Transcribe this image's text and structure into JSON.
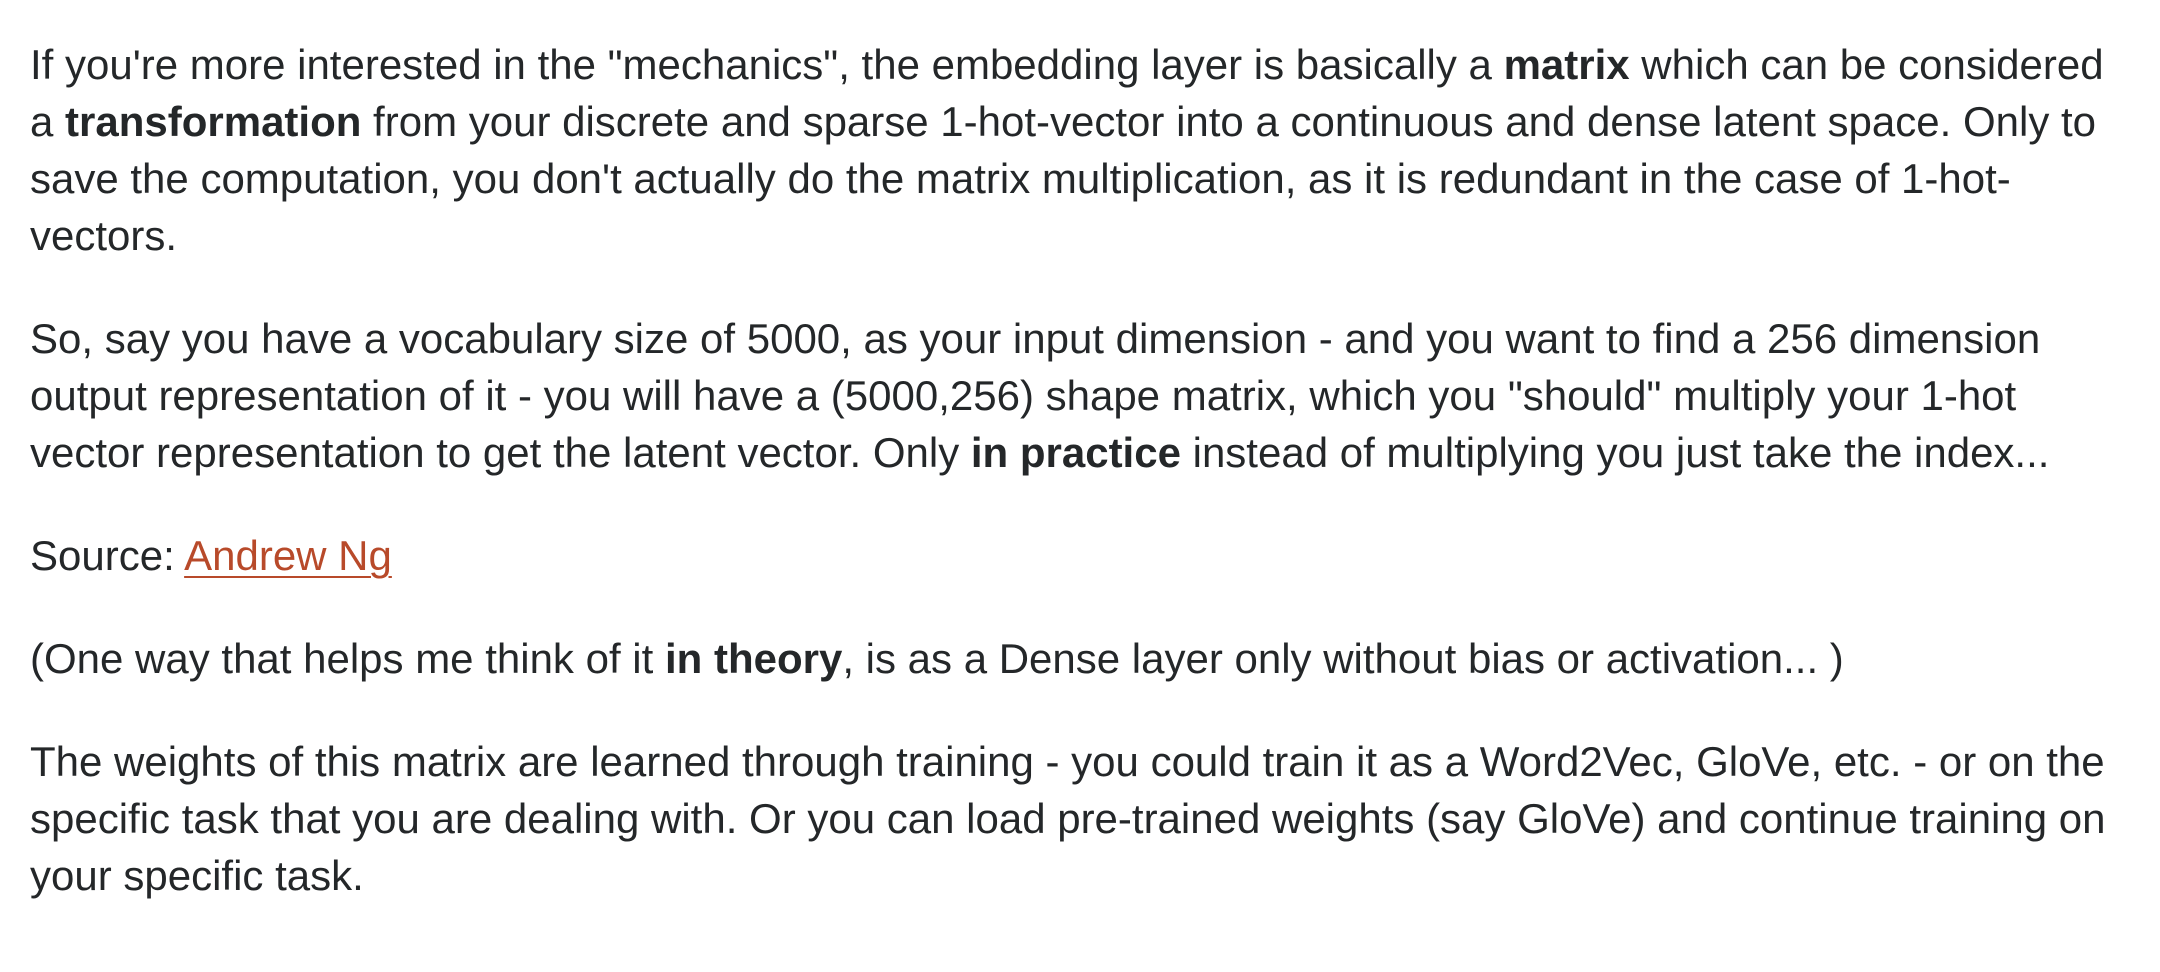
{
  "paragraphs": {
    "p1": {
      "t1": "If you're more interested in the \"mechanics\", the embedding layer is basically a ",
      "b1": "matrix",
      "t2": " which can be considered a ",
      "b2": "transformation",
      "t3": " from your discrete and sparse 1-hot-vector into a continuous and dense latent space. Only to save the computation, you don't actually do the matrix multiplication, as it is redundant in the case of 1-hot-vectors."
    },
    "p2": {
      "t1": "So, say you have a vocabulary size of 5000, as your input dimension - and you want to find a 256 dimension output representation of it - you will have a (5000,256) shape matrix, which you \"should\" multiply your 1-hot vector representation to get the latent vector. Only ",
      "b1": "in practice",
      "t2": " instead of multiplying you just take the index..."
    },
    "p3": {
      "label": "Source: ",
      "link": "Andrew Ng"
    },
    "p4": {
      "t1": "(One way that helps me think of it ",
      "b1": "in theory",
      "t2": ", is as a Dense layer only without bias or activation... )"
    },
    "p5": {
      "t1": "The weights of this matrix are learned through training - you could train it as a Word2Vec, GloVe, etc. - or on the specific task that you are dealing with. Or you can load pre-trained weights (say GloVe) and continue training on your specific task."
    }
  },
  "colors": {
    "text": "#242729",
    "link": "#b84a2a",
    "background": "#ffffff"
  }
}
